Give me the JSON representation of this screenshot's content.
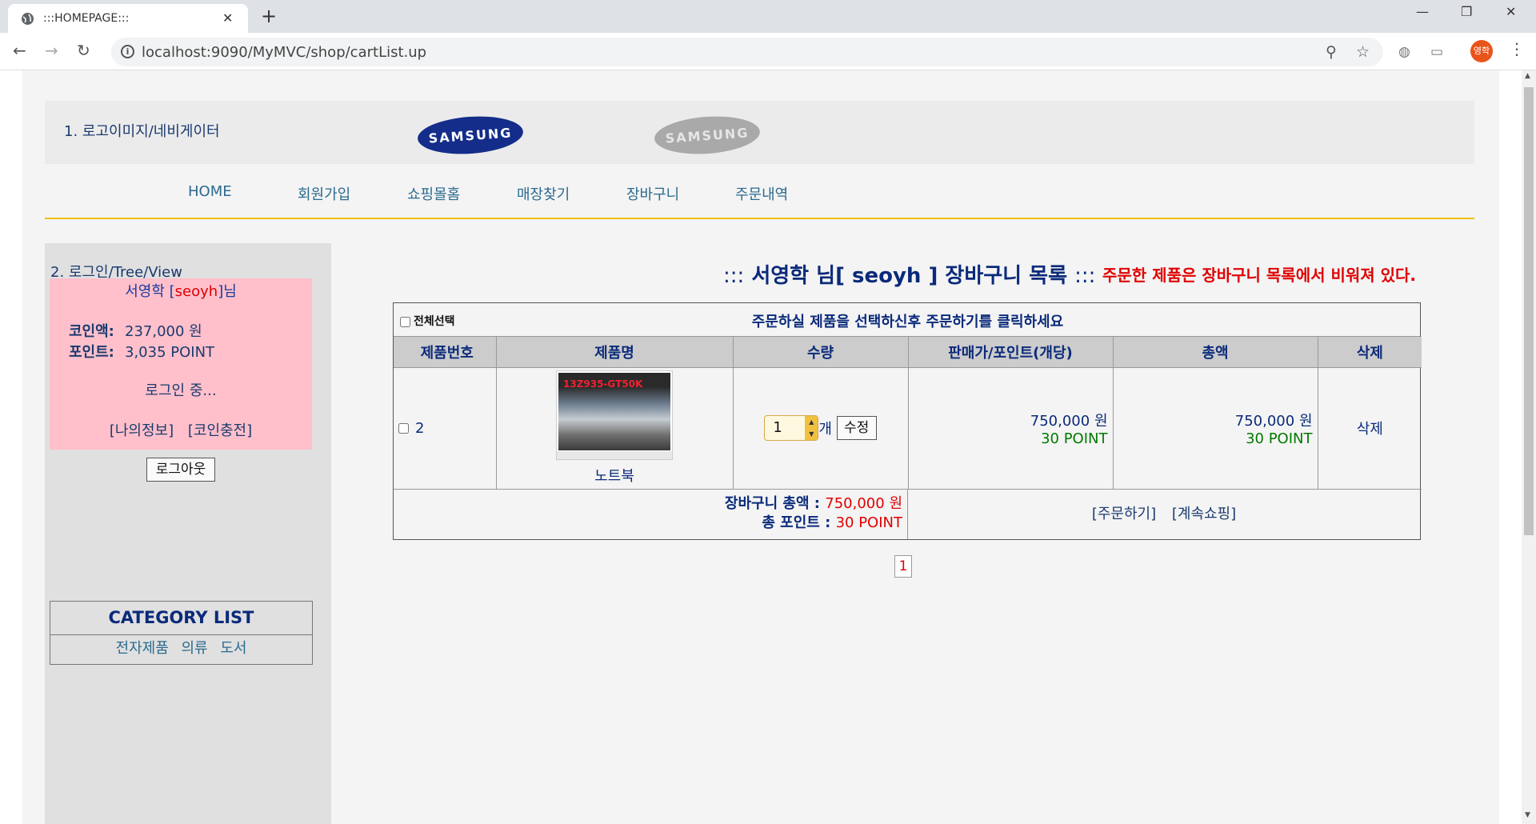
{
  "browser": {
    "tab_title": ":::HOMEPAGE:::",
    "url": "localhost:9090/MyMVC/shop/cartList.up",
    "profile_initials": "영학"
  },
  "header": {
    "text": "1. 로고이미지/네비게이터",
    "logo1": "SAMSUNG",
    "logo2": "SAMSUNG"
  },
  "nav": {
    "items": [
      "HOME",
      "회원가입",
      "쇼핑몰홈",
      "매장찾기",
      "장바구니",
      "주문내역"
    ]
  },
  "sidebar": {
    "title": "2. 로그인/Tree/View",
    "user_name": "서영학",
    "user_id": "seoyh",
    "user_suffix": "님",
    "coin_label": "코인액:",
    "coin_value": "237,000 원",
    "point_label": "포인트:",
    "point_value": "3,035 POINT",
    "status": "로그인 중...",
    "link_myinfo": "[나의정보]",
    "link_charge": "[코인충전]",
    "logout_label": "로그아웃",
    "category_title": "CATEGORY LIST",
    "categories": [
      "전자제품",
      "의류",
      "도서"
    ]
  },
  "main": {
    "title_prefix": ":::",
    "title_name": "서영학 님[ seoyh ] 장바구니 목록",
    "title_suffix": ":::",
    "warning": "주문한 제품은 장바구니 목록에서 비워져 있다.",
    "select_all": "전체선택",
    "instruction": "주문하실 제품을 선택하신후 주문하기를 클릭하세요",
    "columns": [
      "제품번호",
      "제품명",
      "수량",
      "판매가/포인트(개당)",
      "총액",
      "삭제"
    ],
    "rows": [
      {
        "no": "2",
        "product_name": "노트북",
        "image_label": "13Z935-GT50K",
        "qty": "1",
        "qty_unit": "개",
        "edit_label": "수정",
        "price": "750,000 원",
        "price_point": "30 POINT",
        "total": "750,000 원",
        "total_point": "30 POINT",
        "delete_label": "삭제"
      }
    ],
    "sum_total_label": "장바구니 총액 :",
    "sum_total_value": "750,000 원",
    "sum_point_label": "총 포인트 :",
    "sum_point_value": "30 POINT",
    "order_link": "[주문하기]",
    "continue_link": "[계속쇼핑]",
    "page": "1"
  },
  "colors": {
    "accent_line": "#f0c10a",
    "login_bg": "#ffc0cb",
    "warn": "#e00000",
    "navy": "#0a2a7a"
  }
}
